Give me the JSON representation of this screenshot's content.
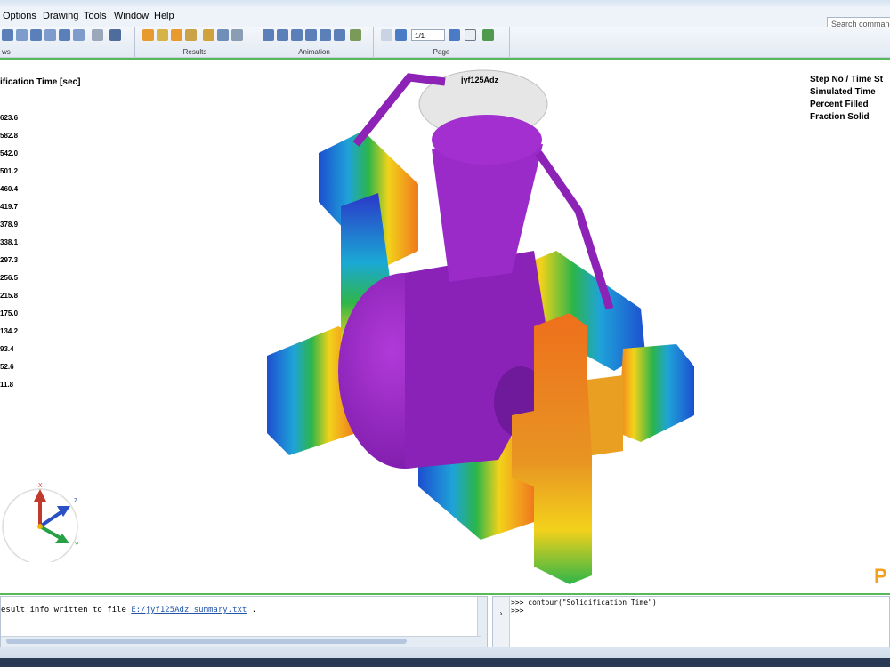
{
  "menu": {
    "items": [
      "Options",
      "Drawing",
      "Tools",
      "Window",
      "Help"
    ]
  },
  "search": {
    "placeholder": "Search command"
  },
  "toolbar": {
    "groups": [
      {
        "label": "ws"
      },
      {
        "label": "Results"
      },
      {
        "label": "Animation"
      },
      {
        "label": "Page"
      }
    ],
    "page_value": "1/1"
  },
  "viewport": {
    "legend": {
      "title": "ification Time [sec]",
      "values": [
        "623.6",
        "582.8",
        "542.0",
        "501.2",
        "460.4",
        "419.7",
        "378.9",
        "338.1",
        "297.3",
        "256.5",
        "215.8",
        "175.0",
        "134.2",
        "93.4",
        "52.6",
        "11.8"
      ]
    },
    "model_name": "jyf125Adz",
    "info": [
      "Step No / Time St",
      "Simulated Time",
      "Percent Filled",
      "Fraction Solid"
    ],
    "axes": {
      "x": "X",
      "y": "Y",
      "z": "Z"
    },
    "brand_letter": "P"
  },
  "console": {
    "prefix": "esult info written to file ",
    "file": "E:/jyf125Adz_summary.txt",
    "suffix": " ."
  },
  "command": {
    "lines": [
      ">>> contour(\"Solidification Time\")",
      ">>>"
    ]
  }
}
